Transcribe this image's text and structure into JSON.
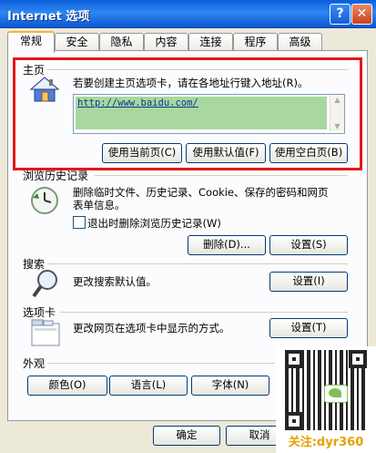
{
  "window": {
    "title": "Internet 选项",
    "help": "?",
    "close": "✕"
  },
  "tabs": [
    "常规",
    "安全",
    "隐私",
    "内容",
    "连接",
    "程序",
    "高级"
  ],
  "home": {
    "group": "主页",
    "instruction": "若要创建主页选项卡，请在各地址行键入地址(R)。",
    "url": "http://www.baidu.com/",
    "buttons": [
      "使用当前页(C)",
      "使用默认值(F)",
      "使用空白页(B)"
    ]
  },
  "history": {
    "group": "浏览历史记录",
    "description_line1": "删除临时文件、历史记录、Cookie、保存的密码和网页",
    "description_line2": "表单信息。",
    "checkbox_label": "退出时删除浏览历史记录(W)",
    "checked": false,
    "delete_button": "删除(D)...",
    "settings_button": "设置(S)"
  },
  "search": {
    "group": "搜索",
    "description": "更改搜索默认值。",
    "settings_button": "设置(I)"
  },
  "tabs_section": {
    "group": "选项卡",
    "description": "更改网页在选项卡中显示的方式。",
    "settings_button": "设置(T)"
  },
  "appearance": {
    "group": "外观",
    "buttons": [
      "颜色(O)",
      "语言(L)",
      "字体(N)"
    ]
  },
  "footer": {
    "ok": "确定",
    "cancel": "取消"
  },
  "watermark": {
    "caption": "关注:dyr360"
  },
  "colors": {
    "titlebar": "#0a5fd8",
    "highlight_box": "#e01818",
    "url_selection": "#a9d7a0"
  }
}
